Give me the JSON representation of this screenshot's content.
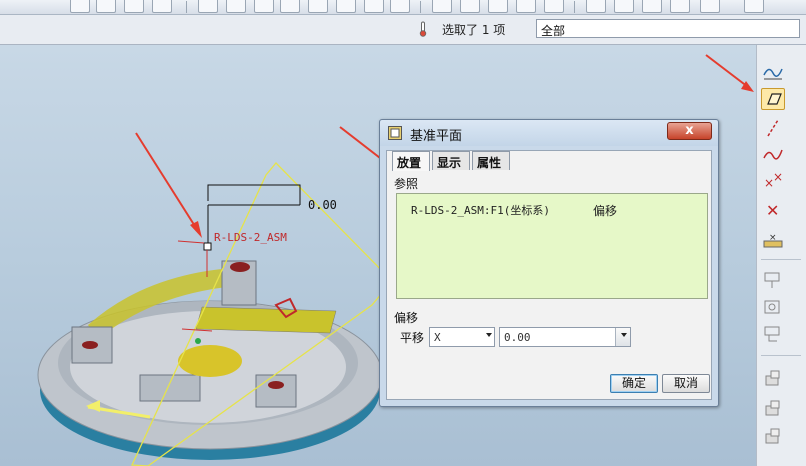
{
  "status_bar": {
    "selection_text": "选取了 1 项",
    "filter_value": "全部"
  },
  "model": {
    "csys_label": "R-LDS-2_ASM",
    "offset_value": "0.00"
  },
  "dialog": {
    "title": "基准平面",
    "close_label": "x",
    "tabs": [
      {
        "label": "放置",
        "active": true
      },
      {
        "label": "显示",
        "active": false
      },
      {
        "label": "属性",
        "active": false
      }
    ],
    "references_label": "参照",
    "reference_item": "R-LDS-2_ASM:F1(坐标系)",
    "reference_constraint": "偏移",
    "offset_section_label": "偏移",
    "translate_label": "平移",
    "axis_value": "X",
    "offset_input_value": "0.00",
    "ok_label": "确定",
    "cancel_label": "取消"
  },
  "right_toolbar": {
    "icons": [
      "datum-curve-icon",
      "datum-plane-icon",
      "datum-axis-icon",
      "sketch-curve-icon",
      "datum-point-icon",
      "datum-csys-icon",
      "analysis-icon",
      "feature-a-icon",
      "feature-b-icon",
      "feature-c-icon",
      "assembly-a-icon",
      "assembly-b-icon",
      "assembly-c-icon"
    ],
    "active_icon": "datum-plane-icon"
  },
  "colors": {
    "accent_arrow": "#e53c2e",
    "reference_box": "#e6f8c8",
    "plane_outline": "#e6e34a",
    "model_base": "#2a7fa1",
    "model_body": "#c9cdd3",
    "highlight_yellow": "#c9c32c"
  }
}
